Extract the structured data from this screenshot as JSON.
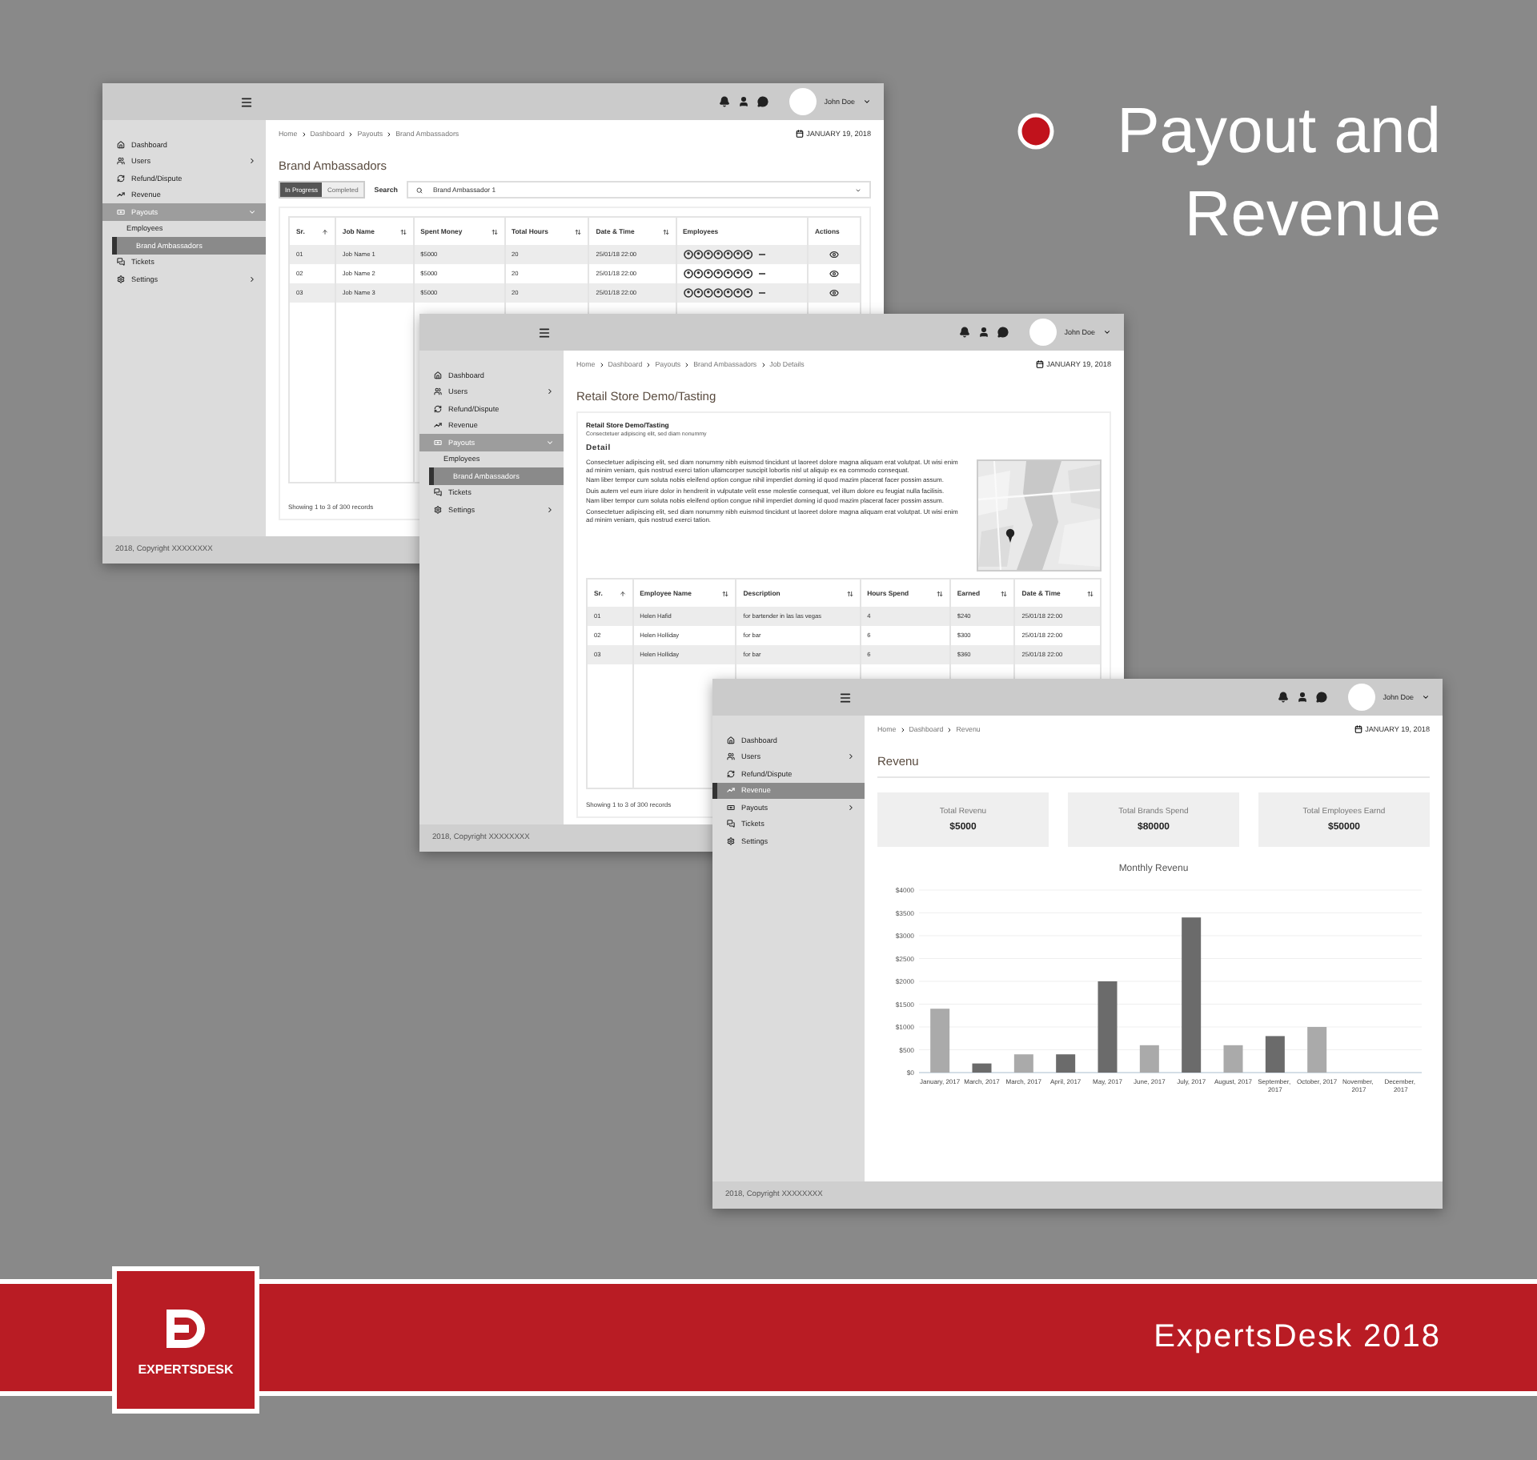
{
  "headline": {
    "title": "Payout and Revenue"
  },
  "screens": [
    {
      "kind": "jobs",
      "user": "John Doe",
      "date": "JANUARY 19, 2018",
      "breadcrumb": [
        "Home",
        "Dashboard",
        "Payouts",
        "Brand Ambassadors"
      ],
      "sidebar": [
        {
          "label": "Dashboard"
        },
        {
          "label": "Users",
          "submenu": true,
          "expanded": false
        },
        {
          "label": "Refund/Dispute"
        },
        {
          "label": "Revenue",
          "selected": false
        },
        {
          "label": "Payouts",
          "submenu": true,
          "expanded": true,
          "children": [
            {
              "label": "Employees",
              "selected": false
            },
            {
              "label": "Brand Ambassadors",
              "selected": true
            }
          ]
        },
        {
          "label": "Tickets"
        },
        {
          "label": "Settings",
          "submenu": true,
          "expanded": false
        }
      ],
      "title": "Brand Ambassadors",
      "tabs": [
        {
          "label": "In Progress",
          "selected": true
        },
        {
          "label": "Completed",
          "selected": false
        }
      ],
      "search": {
        "label": "Search",
        "value": "Brand Ambassador 1"
      },
      "table": {
        "columns": [
          {
            "label": "Sr.",
            "sortable": true
          },
          {
            "label": "Job Name",
            "sortable": true
          },
          {
            "label": "Spent Money",
            "sortable": true
          },
          {
            "label": "Total Hours",
            "sortable": true
          },
          {
            "label": "Date & Time",
            "sortable": true
          },
          {
            "label": "Employees",
            "sortable": false
          },
          {
            "label": "Actions",
            "sortable": false
          }
        ],
        "rows": [
          {
            "cells": [
              "01",
              "Job Name 1",
              "$5000",
              "20",
              "25/01/18 22:00"
            ]
          },
          {
            "cells": [
              "02",
              "Job Name 2",
              "$5000",
              "20",
              "25/01/18 22:00"
            ]
          },
          {
            "cells": [
              "03",
              "Job Name 3",
              "$5000",
              "20",
              "25/01/18 22:00"
            ]
          }
        ]
      },
      "records": "Showing 1 to 3 of 300 records",
      "footer": "2018, Copyright XXXXXXXX"
    },
    {
      "kind": "detail",
      "user": "John Doe",
      "date": "JANUARY 19, 2018",
      "breadcrumb": [
        "Home",
        "Dashboard",
        "Payouts",
        "Brand Ambassadors",
        "Job Details"
      ],
      "sidebar": [
        {
          "label": "Dashboard"
        },
        {
          "label": "Users",
          "submenu": true,
          "expanded": false
        },
        {
          "label": "Refund/Dispute"
        },
        {
          "label": "Revenue",
          "selected": false
        },
        {
          "label": "Payouts",
          "submenu": true,
          "expanded": true,
          "children": [
            {
              "label": "Employees",
              "selected": false
            },
            {
              "label": "Brand Ambassadors",
              "selected": true
            }
          ]
        },
        {
          "label": "Tickets"
        },
        {
          "label": "Settings",
          "submenu": true,
          "expanded": false
        }
      ],
      "title": "Retail Store Demo/Tasting",
      "card": {
        "heading": "Retail Store Demo/Tasting",
        "subheading": "Consectetuer adipiscing elit, sed diam nonummy",
        "section": "Detail",
        "paragraphs": [
          "Consectetuer adipiscing elit, sed diam nonummy nibh euismod tincidunt ut laoreet dolore magna aliquam erat volutpat. Ut wisi enim ad minim veniam, quis nostrud exerci tation ullamcorper suscipit lobortis nisl ut aliquip ex ea commodo consequat.",
          "Nam liber tempor cum soluta nobis eleifend option congue nihil imperdiet doming id quod mazim placerat facer possim assum.",
          "Duis autem vel eum iriure dolor in hendrerit in vulputate velit esse molestie consequat, vel illum dolore eu feugiat nulla facilisis.",
          "Nam liber tempor cum soluta nobis eleifend option congue nihil imperdiet doming id quod mazim placerat facer possim assum.",
          "Consectetuer adipiscing elit, sed diam nonummy nibh euismod tincidunt ut laoreet dolore magna aliquam erat volutpat. Ut wisi enim ad minim veniam, quis nostrud exerci tation."
        ],
        "map": {
          "kind": "picture"
        }
      },
      "table": {
        "columns": [
          {
            "label": "Sr.",
            "sortable": true
          },
          {
            "label": "Employee Name",
            "sortable": true
          },
          {
            "label": "Description",
            "sortable": true
          },
          {
            "label": "Hours Spend",
            "sortable": true
          },
          {
            "label": "Earned",
            "sortable": true
          },
          {
            "label": "Date & Time",
            "sortable": true
          }
        ],
        "rows": [
          {
            "cells": [
              "01",
              "Helen Hafid",
              "for bartender in las las vegas",
              "4",
              "$240",
              "25/01/18 22:00"
            ]
          },
          {
            "cells": [
              "02",
              "Helen Holliday",
              "for bar",
              "6",
              "$300",
              "25/01/18 22:00"
            ]
          },
          {
            "cells": [
              "03",
              "Helen Holliday",
              "for bar",
              "6",
              "$360",
              "25/01/18 22:00"
            ]
          }
        ]
      },
      "records": "Showing 1 to 3 of 300 records",
      "footer": "2018, Copyright XXXXXXXX"
    },
    {
      "kind": "revenue",
      "user": "John Doe",
      "date": "JANUARY 19, 2018",
      "breadcrumb": [
        "Home",
        "Dashboard",
        "Revenu"
      ],
      "sidebar": [
        {
          "label": "Dashboard"
        },
        {
          "label": "Users",
          "submenu": true,
          "expanded": false
        },
        {
          "label": "Refund/Dispute"
        },
        {
          "label": "Revenue",
          "selected": true
        },
        {
          "label": "Payouts",
          "submenu": true,
          "expanded": false
        },
        {
          "label": "Tickets"
        },
        {
          "label": "Settings"
        }
      ],
      "title": "Revenu",
      "stats": [
        {
          "label": "Total Revenu",
          "value": "$5000"
        },
        {
          "label": "Total Brands Spend",
          "value": "$80000"
        },
        {
          "label": "Total Employees Earnd",
          "value": "$50000"
        }
      ],
      "chart_data": {
        "type": "bar",
        "title": "Monthly Revenu",
        "categories": [
          "January, 2017",
          "March, 2017",
          "March, 2017",
          "April, 2017",
          "May, 2017",
          "June, 2017",
          "July, 2017",
          "August, 2017",
          "September, 2017",
          "October, 2017",
          "November, 2017",
          "December, 2017"
        ],
        "series": [
          {
            "color": "#aaaaaa",
            "values": [
              1400,
              null,
              400,
              null,
              null,
              600,
              null,
              600,
              null,
              1000,
              null,
              null
            ]
          },
          {
            "color": "#6b6b6b",
            "values": [
              null,
              200,
              null,
              400,
              2000,
              null,
              3400,
              null,
              800,
              null,
              null,
              null
            ]
          }
        ],
        "grid": true,
        "ylim": [
          0,
          4000
        ],
        "yticks": [
          {
            "value": 0,
            "label": "$0"
          },
          {
            "value": 500,
            "label": "$500"
          },
          {
            "value": 1000,
            "label": "$1000"
          },
          {
            "value": 1500,
            "label": "$1500"
          },
          {
            "value": 2000,
            "label": "$2000"
          },
          {
            "value": 2500,
            "label": "$2500"
          },
          {
            "value": 3000,
            "label": "$3000"
          },
          {
            "value": 3500,
            "label": "$3500"
          },
          {
            "value": 4000,
            "label": "$4000"
          }
        ]
      },
      "footer": "2018, Copyright XXXXXXXX"
    }
  ],
  "brand": {
    "logo_text": "EXPERTSDESK",
    "caption": "ExpertsDesk 2018"
  }
}
